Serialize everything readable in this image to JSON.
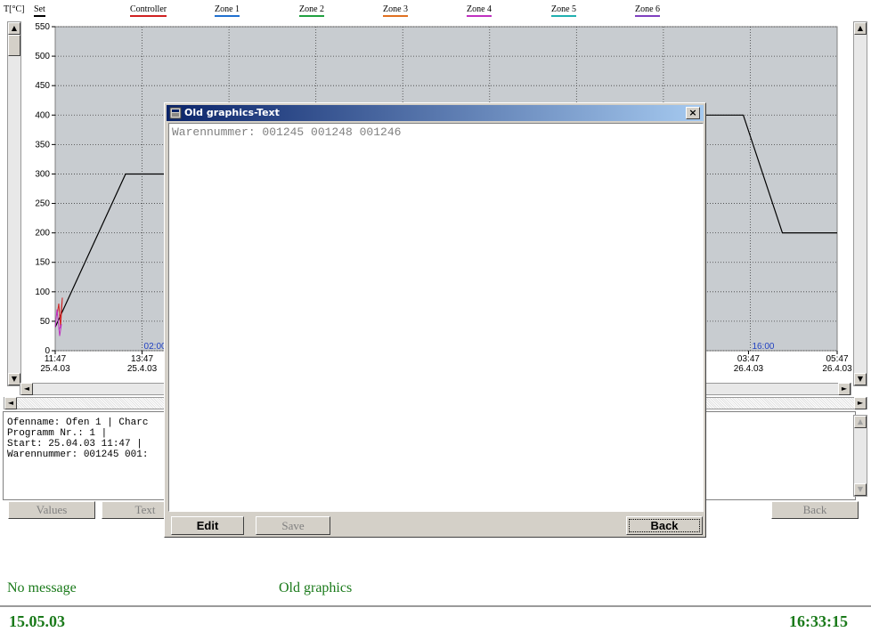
{
  "legend": {
    "items": [
      {
        "label": "T[°C]",
        "color": "#000000",
        "underline": false
      },
      {
        "label": "Set",
        "color": "#000000",
        "underline": true
      },
      {
        "label": "Controller",
        "color": "#d02020",
        "underline": true
      },
      {
        "label": "Zone 1",
        "color": "#2070d0",
        "underline": true
      },
      {
        "label": "Zone 2",
        "color": "#20a040",
        "underline": true
      },
      {
        "label": "Zone 3",
        "color": "#e07020",
        "underline": true
      },
      {
        "label": "Zone 4",
        "color": "#c030c0",
        "underline": true
      },
      {
        "label": "Zone 5",
        "color": "#20b0b0",
        "underline": true
      },
      {
        "label": "Zone 6",
        "color": "#8040c0",
        "underline": true
      }
    ]
  },
  "chart_data": {
    "type": "line",
    "title": "",
    "ylabel": "T[°C]",
    "ylim": [
      0,
      550
    ],
    "yticks": [
      "550",
      "500",
      "450",
      "400",
      "350",
      "300",
      "250",
      "200",
      "150",
      "100",
      "50",
      "0"
    ],
    "xticks": [
      {
        "time": "11:47",
        "date": "25.4.03"
      },
      {
        "time": "13:47",
        "date": "25.4.03"
      },
      {
        "time": "03:47",
        "date": "26.4.03"
      },
      {
        "time": "05:47",
        "date": "26.4.03"
      }
    ],
    "markers": [
      "02:00",
      "16:00"
    ],
    "grid": true,
    "series": [
      {
        "name": "Set",
        "color": "#000000",
        "points": [
          [
            0.0,
            40
          ],
          [
            0.09,
            300
          ],
          [
            0.19,
            300
          ],
          [
            0.23,
            360
          ],
          [
            0.72,
            400
          ],
          [
            0.88,
            400
          ],
          [
            0.93,
            200
          ],
          [
            1.0,
            200
          ]
        ]
      }
    ],
    "controller_spike": {
      "color": "#d02020"
    },
    "zone_spike": {
      "color": "#c030c0"
    }
  },
  "info": {
    "lines": [
      "Ofenname: Ofen 1 | Charc",
      "Programm Nr.: 1 |",
      "Start: 25.04.03 11:47 |",
      "Warennummer: 001245 001:"
    ]
  },
  "buttons": {
    "values": "Values",
    "text": "Text",
    "back": "Back"
  },
  "status": {
    "message": "No message",
    "mode": "Old graphics",
    "date": "15.05.03",
    "time": "16:33:15"
  },
  "dialog": {
    "title": "Old graphics-Text",
    "close": "×",
    "content": "Warennummer: 001245 001248 001246",
    "edit": "Edit",
    "save": "Save",
    "back": "Back"
  },
  "colors": {
    "plot_bg": "#c8ccd0",
    "accent_green": "#1a7a1a",
    "dialog_title": "#0a246a"
  }
}
